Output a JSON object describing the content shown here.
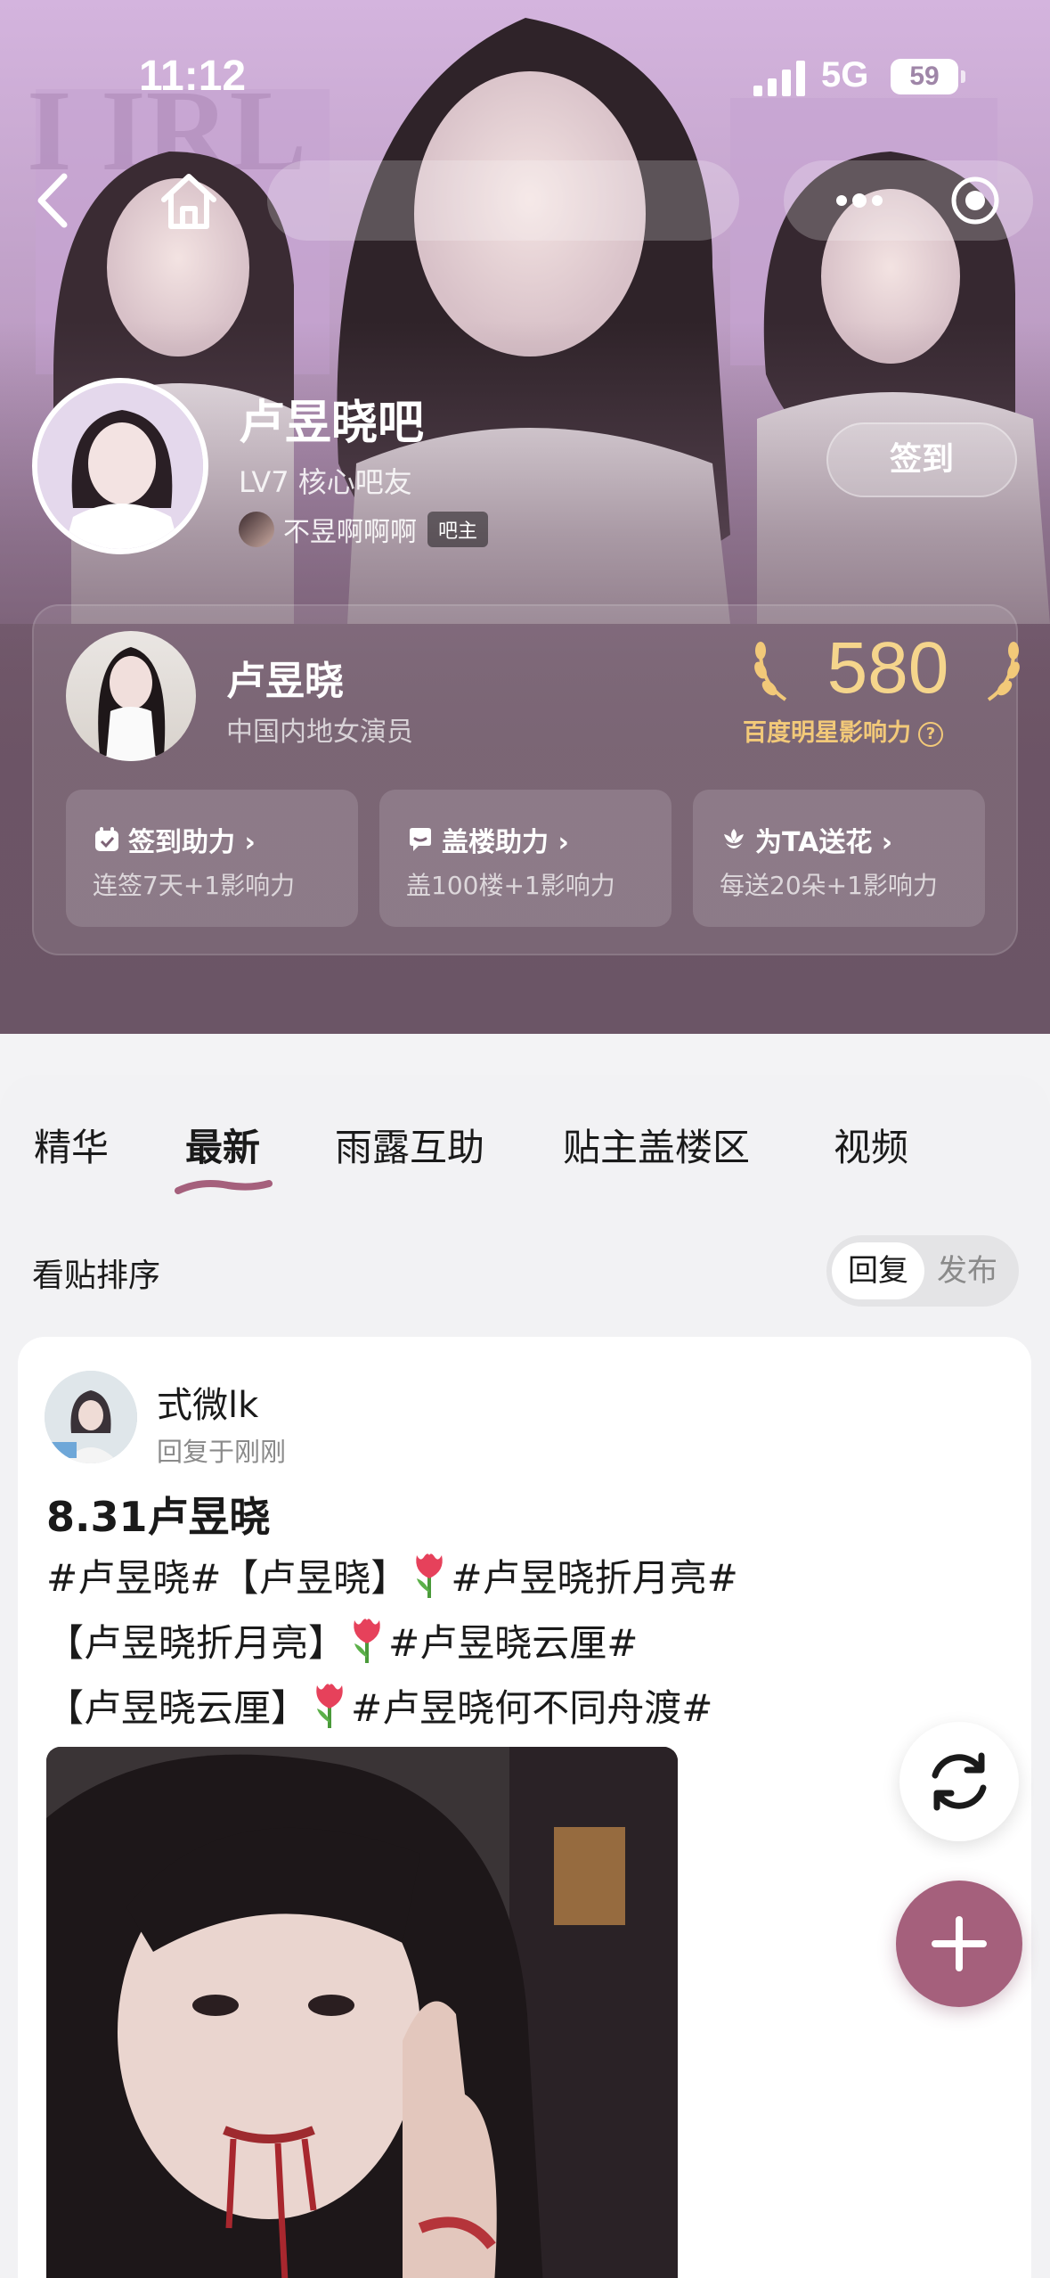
{
  "status_bar": {
    "time": "11:12",
    "network": "5G",
    "battery": "59"
  },
  "forum": {
    "title": "卢昱晓吧",
    "level": "LV7 核心吧友",
    "owner_name": "不昱啊啊啊",
    "owner_badge": "吧主",
    "signin_label": "签到"
  },
  "star": {
    "name": "卢昱晓",
    "job": "中国内地女演员",
    "score": "580",
    "power_label": "百度明星影响力",
    "help_icon": "?",
    "boosts": [
      {
        "title": "签到助力 ›",
        "sub": "连签7天+1影响力",
        "icon": "calendar-check-icon"
      },
      {
        "title": "盖楼助力 ›",
        "sub": "盖100楼+1影响力",
        "icon": "chat-bubble-icon"
      },
      {
        "title": "为TA送花 ›",
        "sub": "每送20朵+1影响力",
        "icon": "flower-icon"
      }
    ]
  },
  "tabs": [
    {
      "label": "精华"
    },
    {
      "label": "最新",
      "active": true
    },
    {
      "label": "雨露互助"
    },
    {
      "label": "贴主盖楼区"
    },
    {
      "label": "视频"
    }
  ],
  "sort": {
    "label": "看贴排序",
    "option_reply": "回复",
    "option_publish": "发布"
  },
  "post": {
    "author": "式微lk",
    "time": "回复于刚刚",
    "title": "8.31卢昱晓",
    "line1_a": "#卢昱晓#【卢昱晓】",
    "line1_b": "#卢昱晓折月亮#",
    "line2_a": "【卢昱晓折月亮】",
    "line2_b": "#卢昱晓云厘#",
    "line3_a": "【卢昱晓云厘】",
    "line3_b": "#卢昱晓何不同舟渡#"
  },
  "colors": {
    "accent": "#a5607c",
    "gold": "#f2c979"
  }
}
